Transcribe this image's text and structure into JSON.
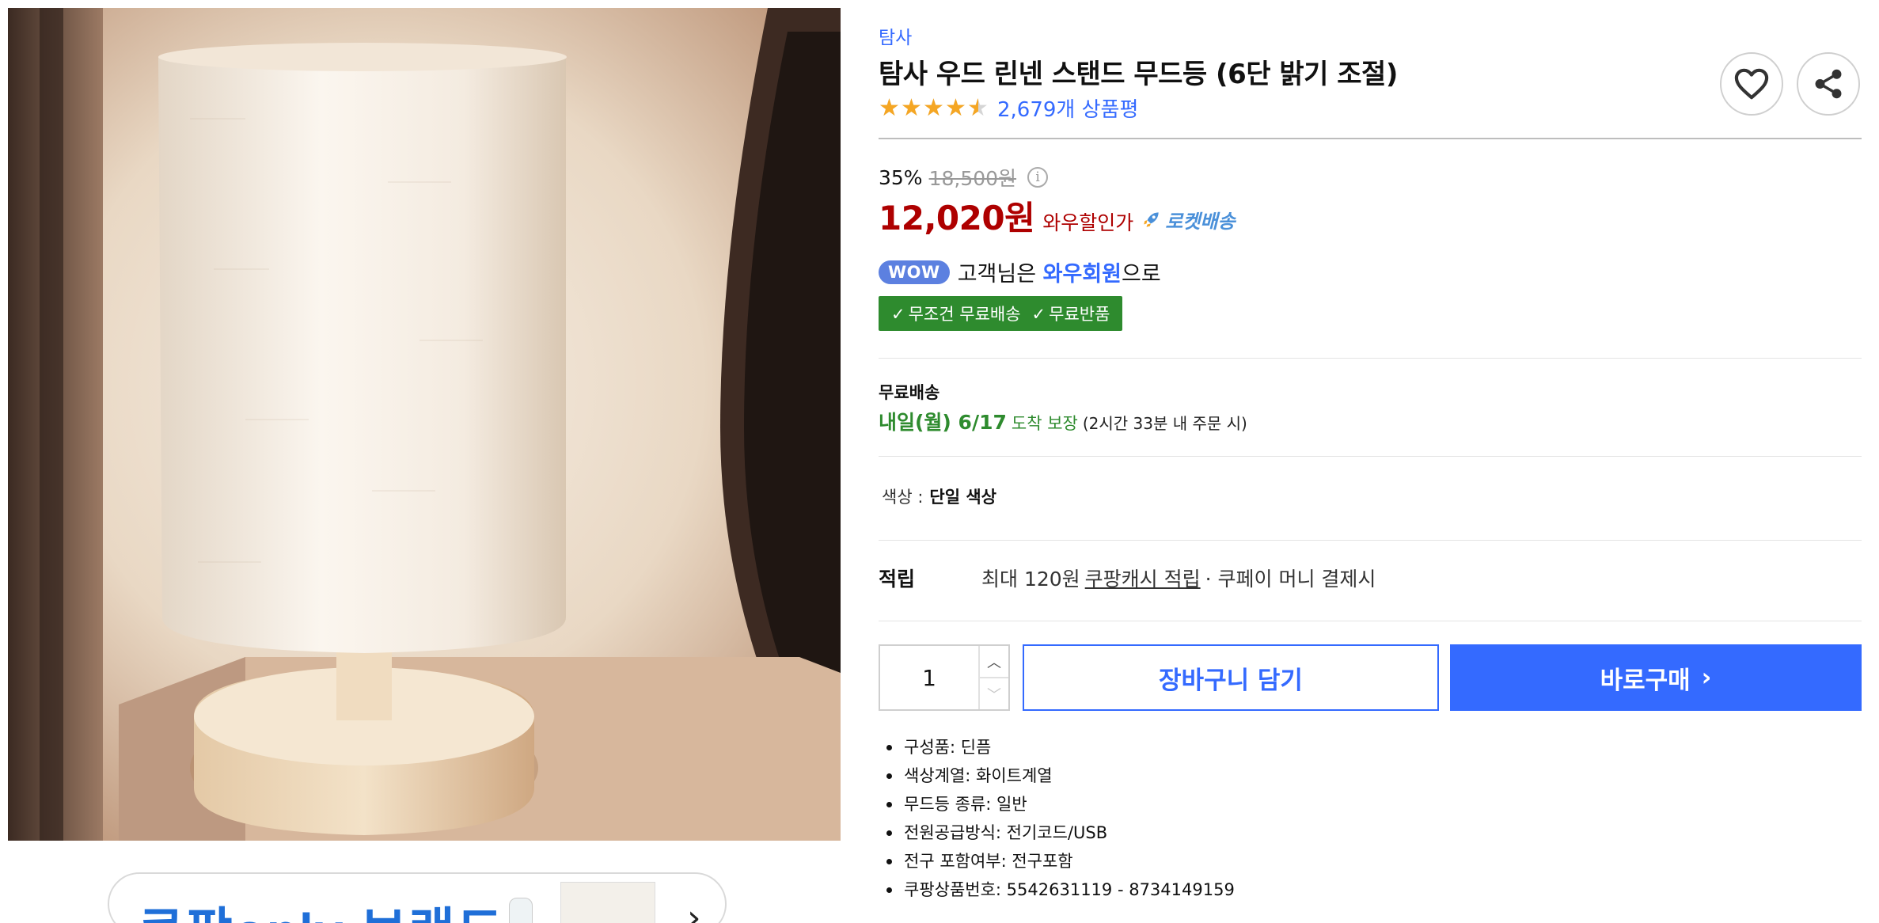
{
  "product": {
    "brand": "탐사",
    "title": "탐사 우드 린넨 스탠드 무드등 (6단 밝기 조절)",
    "rating": 4.5,
    "review_count": "2,679개 상품평",
    "image_alt": "product-image"
  },
  "banner": {
    "text": "쿠팡only 브랜드"
  },
  "actions": {
    "wishlist_icon": "heart-icon",
    "share_icon": "share-icon"
  },
  "price": {
    "discount_rate": "35%",
    "original": "18,500원",
    "info_glyph": "i",
    "sale": "12,020원",
    "sale_label": "와우할인가",
    "rocket_label": "로켓배송"
  },
  "wow": {
    "badge": "WOW",
    "prefix": "고객님은",
    "member": "와우회원",
    "suffix": "으로",
    "free_shipping": "무조건 무료배송",
    "free_return": "무료반품"
  },
  "shipping": {
    "title": "무료배송",
    "date": "내일(월) 6/17",
    "guarantee": "도착 보장",
    "condition": "(2시간 33분 내 주문 시)"
  },
  "option": {
    "label": "색상 :",
    "value": "단일 색상"
  },
  "points": {
    "label": "적립",
    "prefix": "최대 120원",
    "link": "쿠팡캐시 적립",
    "suffix": "· 쿠페이 머니 결제시"
  },
  "purchase": {
    "quantity": "1",
    "cart_label": "장바구니 담기",
    "buy_label": "바로구매"
  },
  "specs": [
    "구성품: 딘픔",
    "색상계열: 화이트계열",
    "무드등 종류: 일반",
    "전원공급방식: 전기코드/USB",
    "전구 포함여부: 전구포함",
    "쿠팡상품번호: 5542631119 - 8734149159"
  ],
  "colors": {
    "accent_blue": "#346aff",
    "price_red": "#ae0000",
    "delivery_green": "#2e8b2e",
    "star_orange": "#f5a623"
  }
}
